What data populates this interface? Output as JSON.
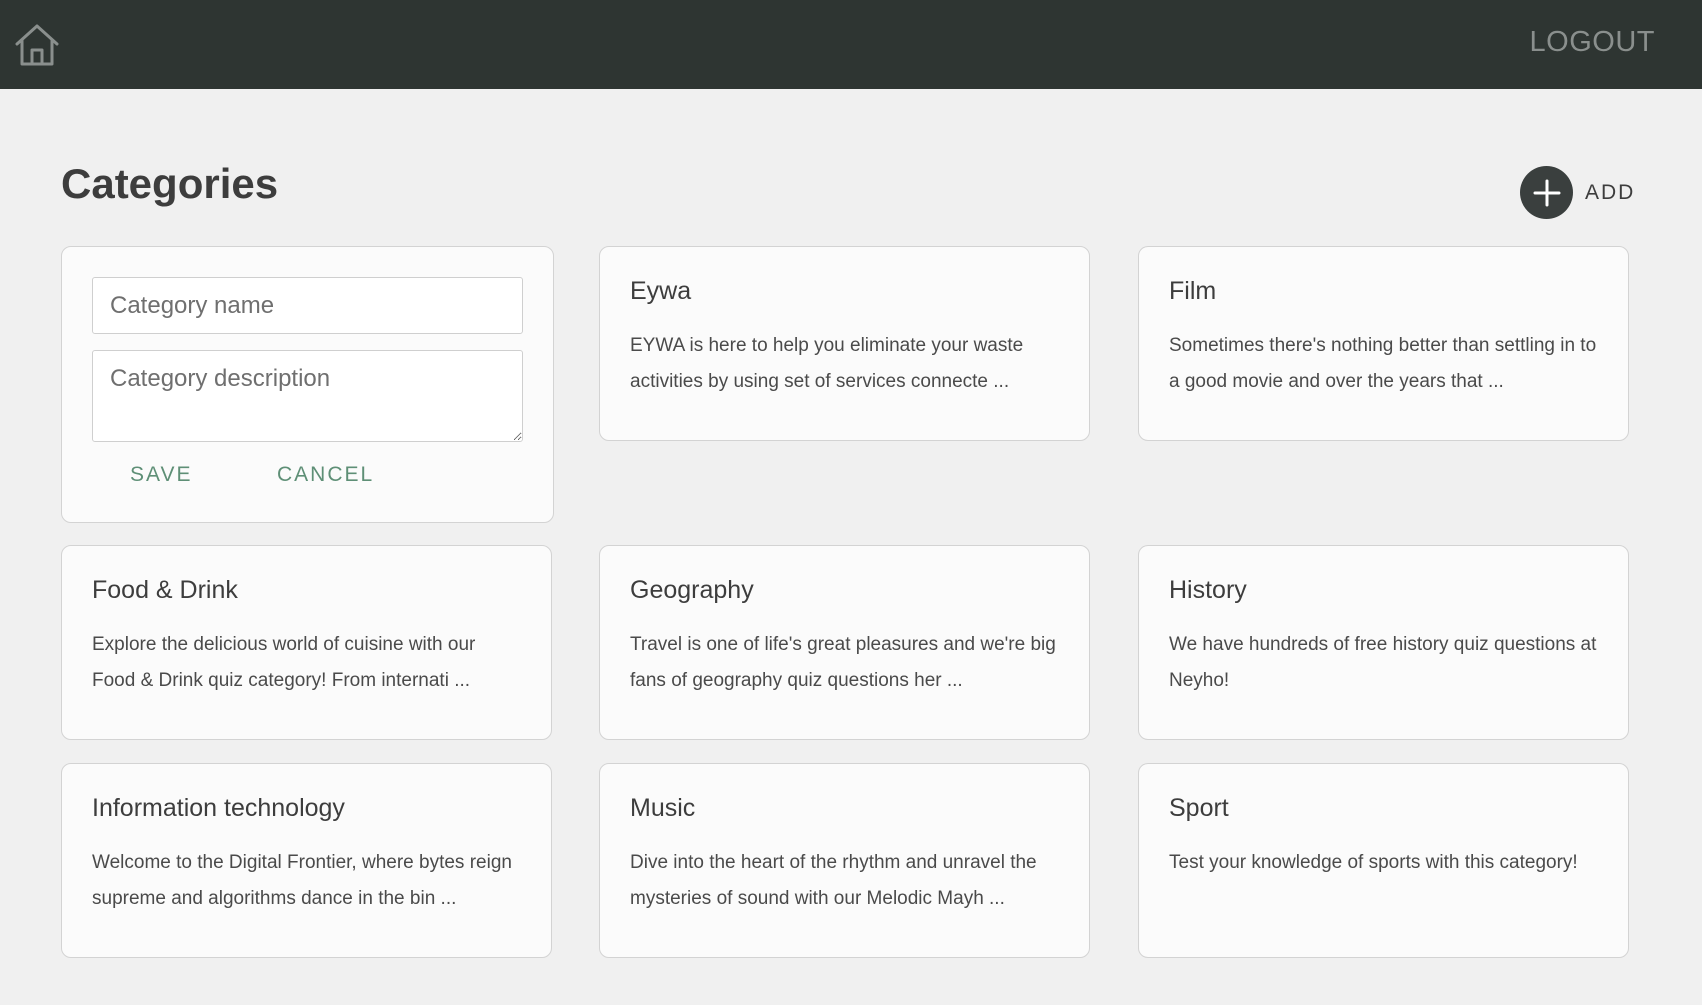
{
  "header": {
    "home_icon": "home-icon",
    "logout_label": "LOGOUT"
  },
  "page": {
    "title": "Categories",
    "add_label": "ADD",
    "add_icon": "plus-icon"
  },
  "form": {
    "name_placeholder": "Category name",
    "name_value": "",
    "description_placeholder": "Category description",
    "description_value": "",
    "save_label": "SAVE",
    "cancel_label": "CANCEL"
  },
  "categories": [
    {
      "title": "Eywa",
      "description": "EYWA is here to help you eliminate your waste activities by using set of services connecte ..."
    },
    {
      "title": "Film",
      "description": "Sometimes there's nothing better than settling in to a good movie and over the years that ..."
    },
    {
      "title": "Food & Drink",
      "description": "Explore the delicious world of cuisine with our Food & Drink quiz category! From internati ..."
    },
    {
      "title": "Geography",
      "description": "Travel is one of life's great pleasures and we're big fans of geography quiz questions her ..."
    },
    {
      "title": "History",
      "description": "We have hundreds of free history quiz questions at Neyho!"
    },
    {
      "title": "Information technology",
      "description": "Welcome to the Digital Frontier, where bytes reign supreme and algorithms dance in the bin ..."
    },
    {
      "title": "Music",
      "description": "Dive into the heart of the rhythm and unravel the mysteries of sound with our Melodic Mayh ..."
    },
    {
      "title": "Sport",
      "description": "Test your knowledge of sports with this category!"
    }
  ],
  "colors": {
    "header_bg": "#2e3532",
    "page_bg": "#f0f0f0",
    "card_bg": "#fbfbfb",
    "accent_green": "#5e8f76",
    "add_button_bg": "#3a3f3e"
  }
}
